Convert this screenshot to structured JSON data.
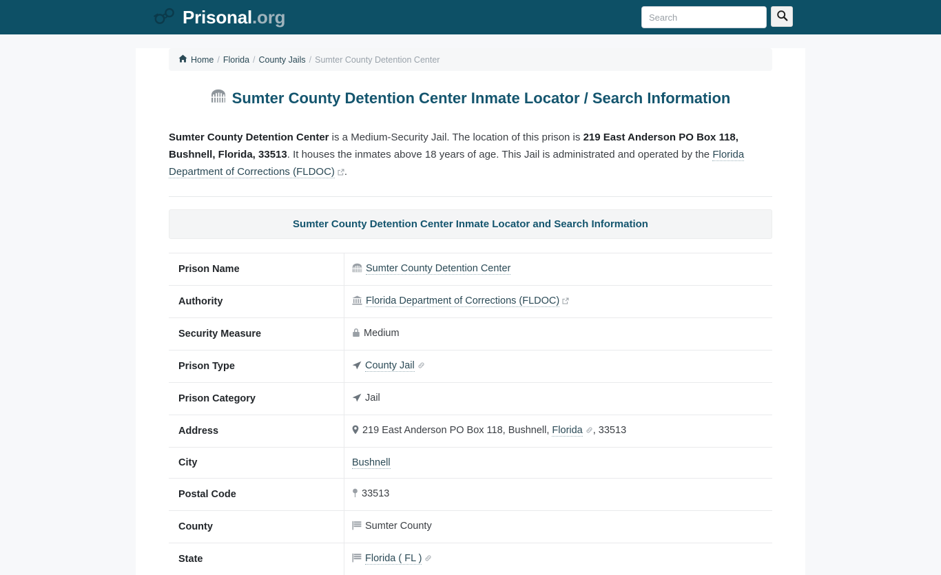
{
  "header": {
    "brand_name": "Prisonal",
    "brand_tld": ".org",
    "logo_icon": "handcuffs-icon",
    "search": {
      "placeholder": "Search",
      "value": "",
      "button_icon": "search-icon"
    }
  },
  "breadcrumb": {
    "home_icon": "home-icon",
    "items": [
      {
        "label": "Home",
        "current": false
      },
      {
        "label": "Florida",
        "current": false
      },
      {
        "label": "County Jails",
        "current": false
      },
      {
        "label": "Sumter County Detention Center",
        "current": true
      }
    ],
    "separator": "/"
  },
  "title": {
    "icon": "jail-building-icon",
    "text": "Sumter County Detention Center Inmate Locator / Search Information"
  },
  "intro": {
    "prison_name": "Sumter County Detention Center",
    "text_1": " is a Medium-Security Jail. The location of this prison is ",
    "address_bold": "219 East Anderson PO Box 118, Bushnell, Florida, 33513",
    "text_2": ". It houses the inmates above 18 years of age. This Jail is administrated and operated by the ",
    "authority_link": "Florida Department of Corrections (FLDOC)",
    "authority_link_icon": "external-link-icon",
    "text_3": "."
  },
  "section_header": "Sumter County Detention Center Inmate Locator and Search Information",
  "table": {
    "rows": [
      {
        "key": "Prison Name",
        "icon": "jail-building-icon",
        "value": "Sumter County Detention Center",
        "is_link": true,
        "after_icon": ""
      },
      {
        "key": "Authority",
        "icon": "bank-icon",
        "value": "Florida Department of Corrections (FLDOC)",
        "is_link": true,
        "after_icon": "external-link-icon"
      },
      {
        "key": "Security Measure",
        "icon": "lock-icon",
        "value": "Medium",
        "is_link": false,
        "after_icon": ""
      },
      {
        "key": "Prison Type",
        "icon": "location-arrow-icon",
        "value": "County Jail",
        "is_link": true,
        "after_icon": "link-chain-icon"
      },
      {
        "key": "Prison Category",
        "icon": "location-arrow-icon",
        "value": "Jail",
        "is_link": false,
        "after_icon": ""
      },
      {
        "key": "Address",
        "icon": "map-marker-icon",
        "value_pre": "219 East Anderson PO Box 118, Bushnell, ",
        "value_link": "Florida",
        "after_icon": "link-chain-icon",
        "value_post": ", 33513",
        "is_composite": true
      },
      {
        "key": "City",
        "icon": "",
        "value": "Bushnell",
        "is_link": true,
        "after_icon": ""
      },
      {
        "key": "Postal Code",
        "icon": "map-pin-icon",
        "value": "33513",
        "is_link": false,
        "after_icon": ""
      },
      {
        "key": "County",
        "icon": "flag-icon",
        "value": "Sumter County",
        "is_link": false,
        "after_icon": ""
      },
      {
        "key": "State",
        "icon": "flag-icon",
        "value": "Florida ( FL )",
        "is_link": true,
        "after_icon": "link-chain-icon"
      }
    ]
  },
  "colors": {
    "header_bg": "#0d5066",
    "accent": "#14556e",
    "link": "#2b4a56",
    "page_bg": "#f7f8fa",
    "content_bg": "#ffffff",
    "muted": "#9aa0a6"
  }
}
